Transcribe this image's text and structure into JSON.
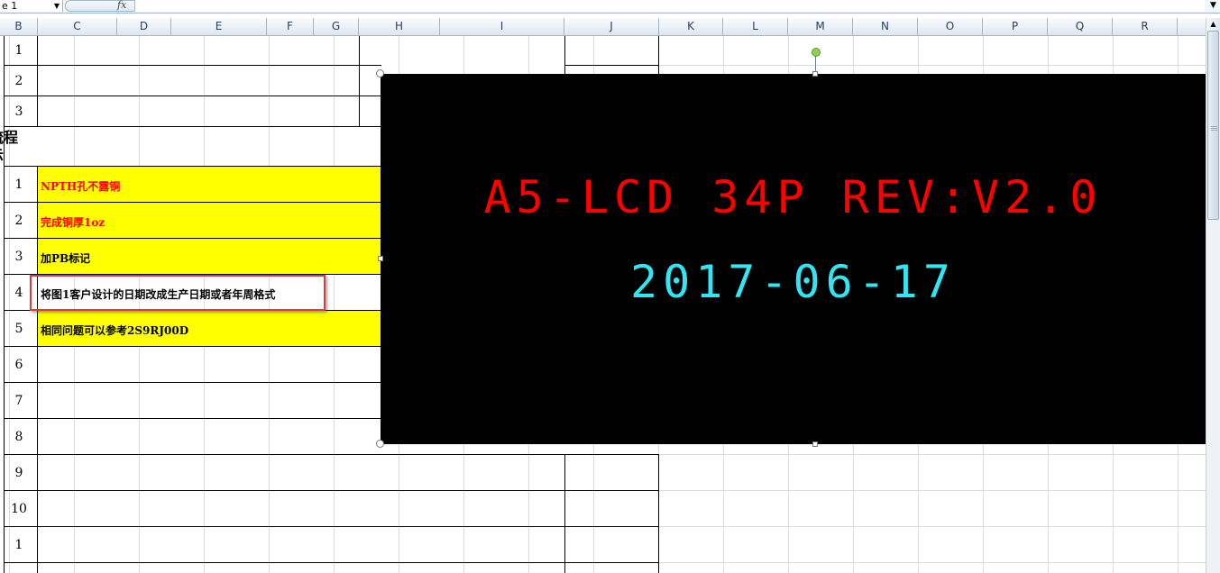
{
  "formula_bar": {
    "name_box": "e 1",
    "fx_label": "fx",
    "formula": ""
  },
  "columns": [
    "B",
    "C",
    "D",
    "E",
    "F",
    "G",
    "H",
    "I",
    "J",
    "K",
    "L",
    "M",
    "N",
    "O",
    "P",
    "Q",
    "R"
  ],
  "rows": [
    {
      "num": "1",
      "text": ""
    },
    {
      "num": "2",
      "text": ""
    },
    {
      "num": "3",
      "text": ""
    },
    {
      "num": "流程\n示",
      "text": ""
    },
    {
      "num": "1",
      "text": "NPTH孔不露铜",
      "color": "#ff0000",
      "fill": "#ffff00"
    },
    {
      "num": "2",
      "text": "完成铜厚1oz",
      "color": "#ff0000",
      "fill": "#ffff00"
    },
    {
      "num": "3",
      "text": "加PB标记",
      "color": "#000000",
      "fill": "#ffff00"
    },
    {
      "num": "4",
      "text": "将图1客户设计的日期改成生产日期或者年周格式",
      "color": "#000000",
      "fill": "#ffffff"
    },
    {
      "num": "5",
      "text": "相同问题可以参考2S9RJ00D",
      "color": "#000000",
      "fill": "#ffff00"
    },
    {
      "num": "6",
      "text": ""
    },
    {
      "num": "7",
      "text": ""
    },
    {
      "num": "8",
      "text": ""
    },
    {
      "num": "9",
      "text": ""
    },
    {
      "num": "10",
      "text": ""
    },
    {
      "num": "1",
      "text": ""
    }
  ],
  "image": {
    "line1": "A5-LCD 34P REV:V2.0",
    "line2": "2017-06-17",
    "line1_color": "#ff0000",
    "line2_color": "#33e5f2"
  },
  "colors": {
    "highlight": "#ffff00",
    "callout_border": "#d04040"
  }
}
